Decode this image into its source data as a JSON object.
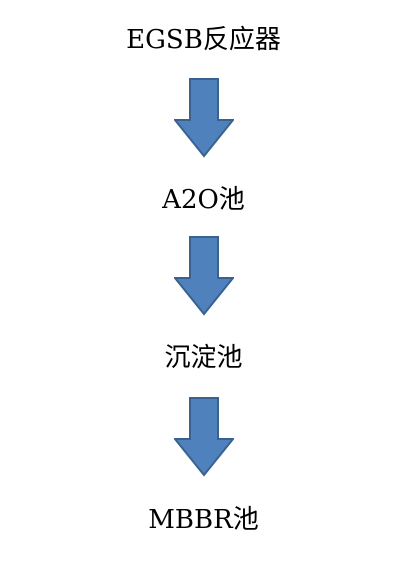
{
  "diagram": {
    "stages": [
      {
        "label": "EGSB反应器"
      },
      {
        "label": "A2O池"
      },
      {
        "label": "沉淀池"
      },
      {
        "label": "MBBR池"
      }
    ],
    "arrow_color": "#4f81bd",
    "arrow_stroke": "#3a6290"
  }
}
